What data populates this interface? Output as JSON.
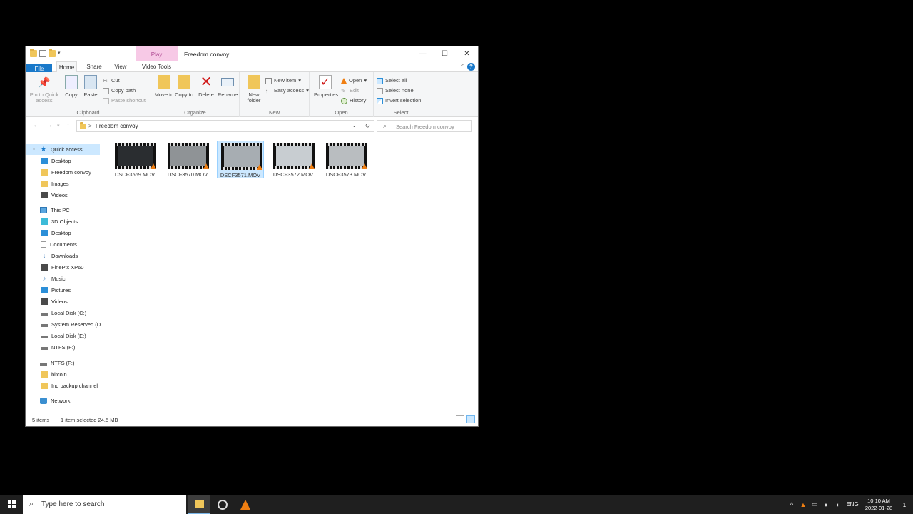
{
  "window": {
    "title": "Freedom convoy",
    "context_tab": "Play",
    "controls": {
      "minimize": "—",
      "maximize": "☐",
      "close": "✕"
    }
  },
  "tabs": {
    "file": "File",
    "home": "Home",
    "share": "Share",
    "view": "View",
    "video_tools": "Video Tools",
    "help": "?",
    "collapse": "^"
  },
  "ribbon": {
    "clipboard": {
      "label": "Clipboard",
      "pin": "Pin to Quick access",
      "copy": "Copy",
      "paste": "Paste",
      "cut": "Cut",
      "copy_path": "Copy path",
      "paste_shortcut": "Paste shortcut"
    },
    "organize": {
      "label": "Organize",
      "move_to": "Move to",
      "copy_to": "Copy to",
      "delete": "Delete",
      "rename": "Rename"
    },
    "new": {
      "label": "New",
      "new_folder": "New folder",
      "new_item": "New item",
      "easy_access": "Easy access"
    },
    "open": {
      "label": "Open",
      "properties": "Properties",
      "open": "Open",
      "edit": "Edit",
      "history": "History"
    },
    "select": {
      "label": "Select",
      "select_all": "Select all",
      "select_none": "Select none",
      "invert_selection": "Invert selection"
    }
  },
  "address": {
    "crumb_sep": ">",
    "path": "Freedom convoy",
    "search_placeholder": "Search Freedom convoy"
  },
  "nav": {
    "quick_access": "Quick access",
    "qa_items": [
      "Desktop",
      "Freedom convoy",
      "Images",
      "Videos"
    ],
    "this_pc": "This PC",
    "pc_items": [
      "3D Objects",
      "Desktop",
      "Documents",
      "Downloads",
      "FinePix XP60",
      "Music",
      "Pictures",
      "Videos",
      "Local Disk (C:)",
      "System Reserved (D",
      "Local Disk (E:)",
      "NTFS (F:)"
    ],
    "ntfs": "NTFS (F:)",
    "ntfs_items": [
      "bitcoin",
      "Ind backup channel"
    ],
    "network": "Network"
  },
  "files": [
    {
      "name": "DSCF3569.MOV",
      "selected": false,
      "tone": "#2a2d30"
    },
    {
      "name": "DSCF3570.MOV",
      "selected": false,
      "tone": "#8f9396"
    },
    {
      "name": "DSCF3571.MOV",
      "selected": true,
      "tone": "#a7adb2"
    },
    {
      "name": "DSCF3572.MOV",
      "selected": false,
      "tone": "#c8cdd1"
    },
    {
      "name": "DSCF3573.MOV",
      "selected": false,
      "tone": "#b9bdc0"
    }
  ],
  "status": {
    "count": "5 items",
    "selected": "1 item selected 24.5 MB"
  },
  "taskbar": {
    "search_text": "Type here to search",
    "lang": "ENG",
    "time": "10:10 AM",
    "date": "2022-01-28",
    "notifications": "1"
  }
}
